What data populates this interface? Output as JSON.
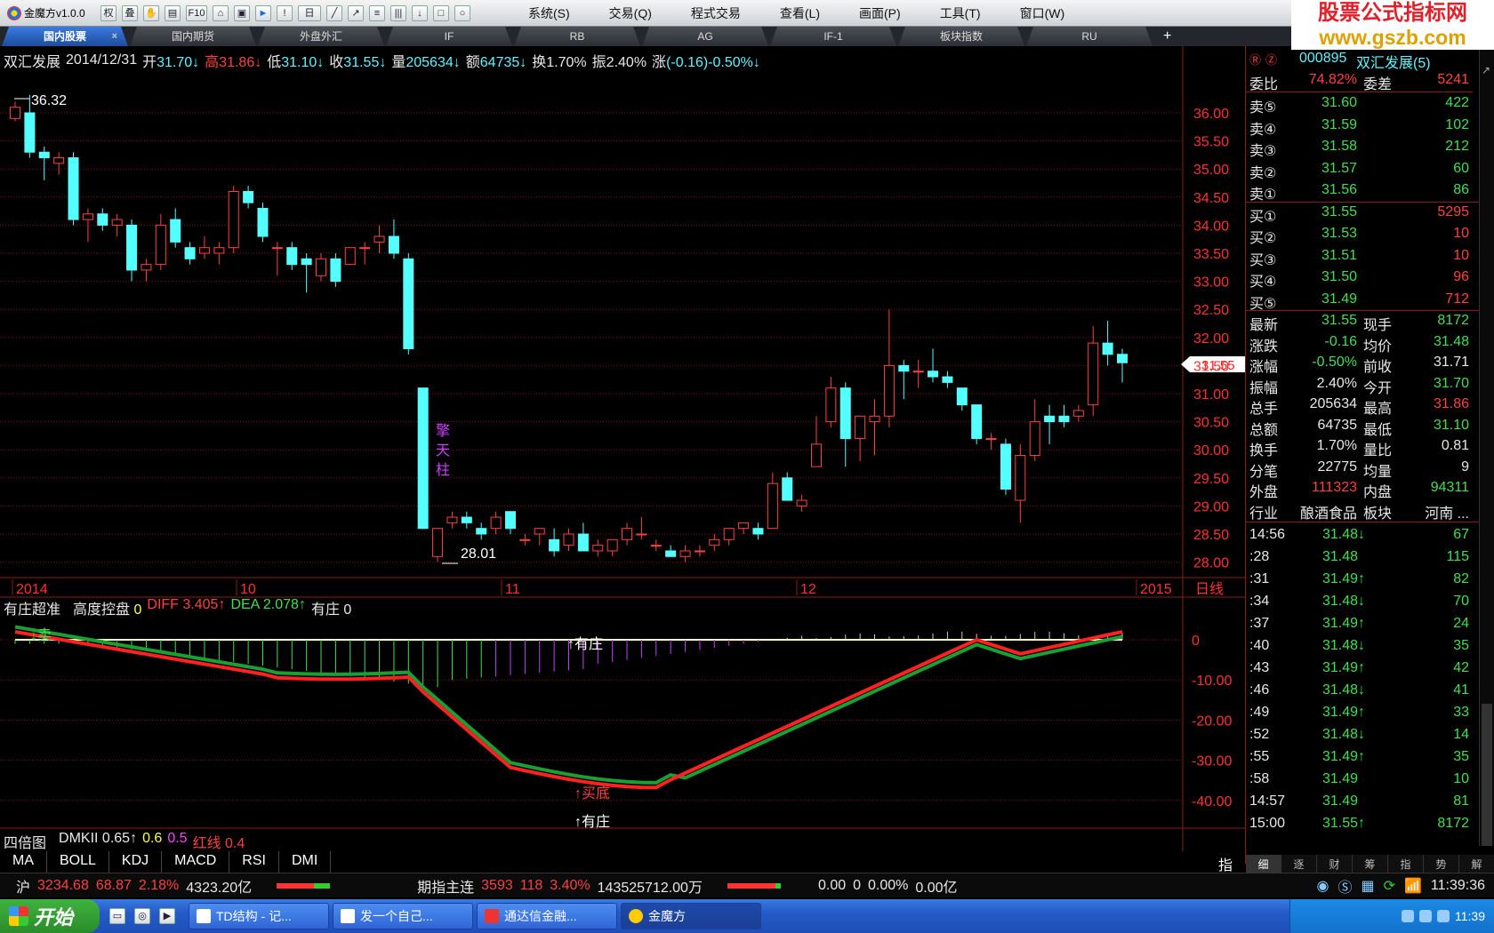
{
  "app": {
    "title": "金魔方v1.0.0"
  },
  "toolbar": {
    "quan": "权",
    "f10": "F10",
    "ri": "日"
  },
  "menu": [
    "系统(S)",
    "交易(Q)",
    "程式交易",
    "查看(L)",
    "画面(P)",
    "工具(T)",
    "窗口(W)"
  ],
  "watermark": {
    "line1": "股票公式指标网",
    "line2": "www.gszb.com"
  },
  "tabs": [
    {
      "label": "国内股票",
      "active": true
    },
    {
      "label": "国内期货"
    },
    {
      "label": "外盘外汇"
    },
    {
      "label": "IF"
    },
    {
      "label": "RB"
    },
    {
      "label": "AG"
    },
    {
      "label": "IF-1"
    },
    {
      "label": "板块指数"
    },
    {
      "label": "RU"
    }
  ],
  "tab_add": "+",
  "info": {
    "name": "双汇发展",
    "date": "2014/12/31",
    "open_l": "开",
    "open": "31.70↓",
    "high_l": "高",
    "high": "31.86↓",
    "low_l": "低",
    "low": "31.10↓",
    "close_l": "收",
    "close": "31.55↓",
    "vol_l": "量",
    "vol": "205634↓",
    "amt_l": "额",
    "amt": "64735↓",
    "turn_l": "换",
    "turn": "1.70%",
    "amp_l": "振",
    "amp": "2.40%",
    "chg_l": "涨",
    "chg": "(-0.16)-0.50%↓"
  },
  "main_chart": {
    "y_ticks": [
      "36.00",
      "35.50",
      "35.00",
      "34.50",
      "34.00",
      "33.50",
      "33.00",
      "32.50",
      "32.00",
      "31.50",
      "31.00",
      "30.50",
      "30.00",
      "29.50",
      "29.00",
      "28.50",
      "28.00"
    ],
    "high_label": "36.32",
    "low_label": "28.01",
    "last_price": "31.55",
    "annotation": [
      "擎",
      "天",
      "柱"
    ],
    "x_labels": [
      "2014",
      "10",
      "11",
      "12",
      "2015"
    ],
    "period": "日线"
  },
  "chart_data": {
    "type": "candlestick",
    "period": "日线",
    "ylim": [
      28.0,
      36.32
    ],
    "candles": [
      [
        35.9,
        36.2,
        35.85,
        36.1
      ],
      [
        36.0,
        36.32,
        35.2,
        35.3
      ],
      [
        35.3,
        35.4,
        34.8,
        35.2
      ],
      [
        35.1,
        35.3,
        34.9,
        35.2
      ],
      [
        35.2,
        35.3,
        34.0,
        34.1
      ],
      [
        34.1,
        34.3,
        33.7,
        34.2
      ],
      [
        34.2,
        34.3,
        33.9,
        34.0
      ],
      [
        34.0,
        34.2,
        33.8,
        34.1
      ],
      [
        34.0,
        34.1,
        33.0,
        33.2
      ],
      [
        33.2,
        33.4,
        33.0,
        33.3
      ],
      [
        33.3,
        34.2,
        33.2,
        34.0
      ],
      [
        34.1,
        34.3,
        33.6,
        33.7
      ],
      [
        33.6,
        33.7,
        33.3,
        33.4
      ],
      [
        33.5,
        33.8,
        33.4,
        33.6
      ],
      [
        33.5,
        33.7,
        33.3,
        33.6
      ],
      [
        33.6,
        34.7,
        33.5,
        34.6
      ],
      [
        34.6,
        34.7,
        34.3,
        34.4
      ],
      [
        34.3,
        34.4,
        33.7,
        33.8
      ],
      [
        33.6,
        33.7,
        33.1,
        33.6
      ],
      [
        33.6,
        33.7,
        33.2,
        33.3
      ],
      [
        33.4,
        33.5,
        32.8,
        33.3
      ],
      [
        33.1,
        33.5,
        33.0,
        33.4
      ],
      [
        33.4,
        33.5,
        32.9,
        33.0
      ],
      [
        33.3,
        33.6,
        33.3,
        33.6
      ],
      [
        33.6,
        33.7,
        33.3,
        33.6
      ],
      [
        33.7,
        34.0,
        33.5,
        33.8
      ],
      [
        33.8,
        34.1,
        33.4,
        33.5
      ],
      [
        33.4,
        33.5,
        31.7,
        31.8
      ],
      [
        31.1,
        31.1,
        28.6,
        28.6
      ],
      [
        28.1,
        28.1,
        28.01,
        28.6
      ],
      [
        28.7,
        28.9,
        28.6,
        28.8
      ],
      [
        28.8,
        28.9,
        28.6,
        28.7
      ],
      [
        28.6,
        28.7,
        28.4,
        28.5
      ],
      [
        28.6,
        28.9,
        28.5,
        28.8
      ],
      [
        28.9,
        28.9,
        28.5,
        28.6
      ],
      [
        28.4,
        28.5,
        28.3,
        28.4
      ],
      [
        28.5,
        28.6,
        28.3,
        28.6
      ],
      [
        28.4,
        28.6,
        28.1,
        28.2
      ],
      [
        28.3,
        28.6,
        28.2,
        28.5
      ],
      [
        28.5,
        28.7,
        28.2,
        28.2
      ],
      [
        28.2,
        28.4,
        28.1,
        28.3
      ],
      [
        28.2,
        28.4,
        28.1,
        28.4
      ],
      [
        28.4,
        28.7,
        28.3,
        28.6
      ],
      [
        28.5,
        28.8,
        28.4,
        28.5
      ],
      [
        28.3,
        28.4,
        28.2,
        28.3
      ],
      [
        28.2,
        28.3,
        28.1,
        28.1
      ],
      [
        28.1,
        28.3,
        28.0,
        28.2
      ],
      [
        28.2,
        28.3,
        28.1,
        28.2
      ],
      [
        28.3,
        28.5,
        28.2,
        28.4
      ],
      [
        28.4,
        28.6,
        28.3,
        28.6
      ],
      [
        28.6,
        28.7,
        28.5,
        28.7
      ],
      [
        28.6,
        28.7,
        28.4,
        28.5
      ],
      [
        28.6,
        29.6,
        28.6,
        29.4
      ],
      [
        29.5,
        29.6,
        29.1,
        29.1
      ],
      [
        29.0,
        29.2,
        28.9,
        29.1
      ],
      [
        29.7,
        30.6,
        29.7,
        30.1
      ],
      [
        30.5,
        31.3,
        30.4,
        31.1
      ],
      [
        31.1,
        31.2,
        29.7,
        30.2
      ],
      [
        30.2,
        30.5,
        29.8,
        30.6
      ],
      [
        30.5,
        30.9,
        29.9,
        30.6
      ],
      [
        30.6,
        32.5,
        30.4,
        31.5
      ],
      [
        31.5,
        31.6,
        30.9,
        31.4
      ],
      [
        31.4,
        31.6,
        31.1,
        31.4
      ],
      [
        31.4,
        31.8,
        31.2,
        31.3
      ],
      [
        31.3,
        31.4,
        31.1,
        31.2
      ],
      [
        31.1,
        31.1,
        30.7,
        30.8
      ],
      [
        30.8,
        30.8,
        30.1,
        30.2
      ],
      [
        30.2,
        30.3,
        30.0,
        30.2
      ],
      [
        30.1,
        30.2,
        29.2,
        29.3
      ],
      [
        29.1,
        30.1,
        28.7,
        29.9
      ],
      [
        29.9,
        30.9,
        29.8,
        30.5
      ],
      [
        30.6,
        30.8,
        30.1,
        30.5
      ],
      [
        30.6,
        30.8,
        30.4,
        30.5
      ],
      [
        30.6,
        30.8,
        30.5,
        30.7
      ],
      [
        30.8,
        32.2,
        30.6,
        31.9
      ],
      [
        31.9,
        32.3,
        31.5,
        31.7
      ],
      [
        31.7,
        31.8,
        31.2,
        31.55
      ]
    ]
  },
  "indicator1": {
    "name": "有庄超准",
    "line_a": "高度控盘",
    "line_a_val": "0",
    "diff_l": "DIFF",
    "diff": "3.405↑",
    "dea_l": "DEA",
    "dea": "2.078↑",
    "yz_l": "有庄",
    "yz": "0",
    "y_ticks": [
      "0",
      "-10.00",
      "-20.00",
      "-30.00",
      "-40.00"
    ],
    "marks": {
      "sell": "↓卖",
      "yz_top": "↑有庄",
      "bottom": "↑买底",
      "yz_bot": "↑有庄"
    }
  },
  "indicator2": {
    "name": "四倍图",
    "dmk_l": "DMKII",
    "dmk": "0.65↑",
    "v1": "0.6",
    "v2": "0.5",
    "red_l": "红线",
    "red": "0.4"
  },
  "bottom_tabs": [
    "MA",
    "BOLL",
    "KDJ",
    "MACD",
    "RSI",
    "DMI"
  ],
  "bottom_right": "指",
  "quote": {
    "code": "000895",
    "name": "双汇发展(5)",
    "wb_l": "委比",
    "wb": "74.82%",
    "wc_l": "委差",
    "wc": "5241",
    "asks": [
      {
        "label": "卖⑤",
        "price": "31.60",
        "vol": "422"
      },
      {
        "label": "卖④",
        "price": "31.59",
        "vol": "102"
      },
      {
        "label": "卖③",
        "price": "31.58",
        "vol": "212"
      },
      {
        "label": "卖②",
        "price": "31.57",
        "vol": "60"
      },
      {
        "label": "卖①",
        "price": "31.56",
        "vol": "86"
      }
    ],
    "bids": [
      {
        "label": "买①",
        "price": "31.55",
        "vol": "5295"
      },
      {
        "label": "买②",
        "price": "31.53",
        "vol": "10"
      },
      {
        "label": "买③",
        "price": "31.51",
        "vol": "10"
      },
      {
        "label": "买④",
        "price": "31.50",
        "vol": "96"
      },
      {
        "label": "买⑤",
        "price": "31.49",
        "vol": "712"
      }
    ],
    "stats": [
      {
        "l1": "最新",
        "v1": "31.55",
        "c1": "g",
        "l2": "现手",
        "v2": "8172",
        "c2": "g"
      },
      {
        "l1": "涨跌",
        "v1": "-0.16",
        "c1": "g",
        "l2": "均价",
        "v2": "31.48",
        "c2": "g"
      },
      {
        "l1": "涨幅",
        "v1": "-0.50%",
        "c1": "g",
        "l2": "前收",
        "v2": "31.71",
        "c2": "w"
      },
      {
        "l1": "振幅",
        "v1": "2.40%",
        "c1": "w",
        "l2": "今开",
        "v2": "31.70",
        "c2": "g"
      },
      {
        "l1": "总手",
        "v1": "205634",
        "c1": "w",
        "l2": "最高",
        "v2": "31.86",
        "c2": "r"
      },
      {
        "l1": "总额",
        "v1": "64735",
        "c1": "w",
        "l2": "最低",
        "v2": "31.10",
        "c2": "g"
      },
      {
        "l1": "换手",
        "v1": "1.70%",
        "c1": "w",
        "l2": "量比",
        "v2": "0.81",
        "c2": "w"
      },
      {
        "l1": "分笔",
        "v1": "22775",
        "c1": "w",
        "l2": "均量",
        "v2": "9",
        "c2": "w"
      },
      {
        "l1": "外盘",
        "v1": "111323",
        "c1": "r",
        "l2": "内盘",
        "v2": "94311",
        "c2": "g"
      },
      {
        "l1": "行业",
        "v1": "酿酒食品",
        "c1": "w",
        "l2": "板块",
        "v2": "河南 ...",
        "c2": "w"
      }
    ],
    "ticks": [
      {
        "t": "14:56",
        "p": "31.48↓",
        "pc": "g",
        "v": "67"
      },
      {
        "t": ":28",
        "p": "31.48",
        "pc": "g",
        "v": "115"
      },
      {
        "t": ":31",
        "p": "31.49↑",
        "pc": "g",
        "v": "82"
      },
      {
        "t": ":34",
        "p": "31.48↓",
        "pc": "g",
        "v": "70"
      },
      {
        "t": ":37",
        "p": "31.49↑",
        "pc": "g",
        "v": "24"
      },
      {
        "t": ":40",
        "p": "31.48↓",
        "pc": "g",
        "v": "35"
      },
      {
        "t": ":43",
        "p": "31.49↑",
        "pc": "g",
        "v": "42"
      },
      {
        "t": ":46",
        "p": "31.48↓",
        "pc": "g",
        "v": "41"
      },
      {
        "t": ":49",
        "p": "31.49↑",
        "pc": "g",
        "v": "33"
      },
      {
        "t": ":52",
        "p": "31.48↓",
        "pc": "g",
        "v": "14"
      },
      {
        "t": ":55",
        "p": "31.49↑",
        "pc": "g",
        "v": "35"
      },
      {
        "t": ":58",
        "p": "31.49",
        "pc": "g",
        "v": "10"
      },
      {
        "t": "14:57",
        "p": "31.49",
        "pc": "g",
        "v": "81"
      },
      {
        "t": "15:00",
        "p": "31.55↑",
        "pc": "g",
        "v": "8172"
      }
    ],
    "side_tabs": [
      "细",
      "逐",
      "财",
      "筹",
      "指",
      "势",
      "解"
    ]
  },
  "status": {
    "sh_l": "沪",
    "sh": "3234.68",
    "sh_chg": "68.87",
    "sh_pct": "2.18%",
    "sh_amt": "4323.20亿",
    "fut_l": "期指主连",
    "fut": "3593",
    "fut_chg": "118",
    "fut_pct": "3.40%",
    "fut_amt": "143525712.00万",
    "x1": "0.00",
    "x2": "0",
    "x3": "0.00%",
    "x4": "0.00亿",
    "clock": "11:39:36"
  },
  "taskbar": {
    "start": "开始",
    "tasks": [
      "TD结构 - 记...",
      "发一个自己...",
      "通达信金融...",
      "金魔方"
    ],
    "time": "11:39"
  }
}
